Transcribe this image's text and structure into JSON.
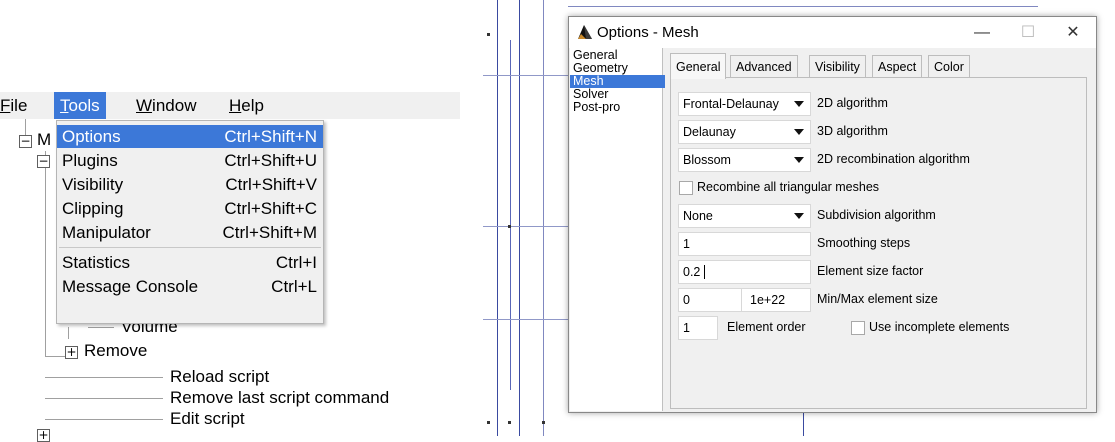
{
  "menubar": {
    "items": [
      {
        "label": "File",
        "key": "F"
      },
      {
        "label": "Tools",
        "key": "T"
      },
      {
        "label": "Window",
        "key": "W"
      },
      {
        "label": "Help",
        "key": "H"
      }
    ]
  },
  "tools_menu": {
    "items": [
      {
        "label": "Options",
        "shortcut": "Ctrl+Shift+N"
      },
      {
        "label": "Plugins",
        "shortcut": "Ctrl+Shift+U"
      },
      {
        "label": "Visibility",
        "shortcut": "Ctrl+Shift+V"
      },
      {
        "label": "Clipping",
        "shortcut": "Ctrl+Shift+C"
      },
      {
        "label": "Manipulator",
        "shortcut": "Ctrl+Shift+M"
      },
      {
        "label": "Statistics",
        "shortcut": "Ctrl+I"
      },
      {
        "label": "Message Console",
        "shortcut": "Ctrl+L"
      }
    ]
  },
  "tree": {
    "items": [
      "Volume",
      "Remove",
      "Reload script",
      "Remove last script command",
      "Edit script"
    ],
    "partial_root": "M"
  },
  "dialog": {
    "title": "Options - Mesh",
    "window_buttons": {
      "minimize": "—",
      "maximize": "☐",
      "close": "✕"
    },
    "categories": [
      "General",
      "Geometry",
      "Mesh",
      "Solver",
      "Post-pro"
    ],
    "tabs": [
      "General",
      "Advanced",
      "Visibility",
      "Aspect",
      "Color"
    ],
    "algo2d": {
      "value": "Frontal-Delaunay",
      "label": "2D algorithm"
    },
    "algo3d": {
      "value": "Delaunay",
      "label": "3D algorithm"
    },
    "recomb_algo": {
      "value": "Blossom",
      "label": "2D recombination algorithm"
    },
    "recombine_all": {
      "label": "Recombine all triangular meshes",
      "checked": false
    },
    "subdivision": {
      "value": "None",
      "label": "Subdivision algorithm"
    },
    "smoothing": {
      "value": "1",
      "label": "Smoothing steps"
    },
    "size_factor": {
      "value": "0.2",
      "label": "Element size factor"
    },
    "minmax": {
      "min": "0",
      "max": "1e+22",
      "label": "Min/Max element size"
    },
    "order": {
      "value": "1",
      "label": "Element order"
    },
    "incomplete": {
      "label": "Use incomplete elements",
      "checked": false
    }
  },
  "colors": {
    "highlight": "#3c78d8",
    "mesh_lines": "#3a4aa0"
  }
}
